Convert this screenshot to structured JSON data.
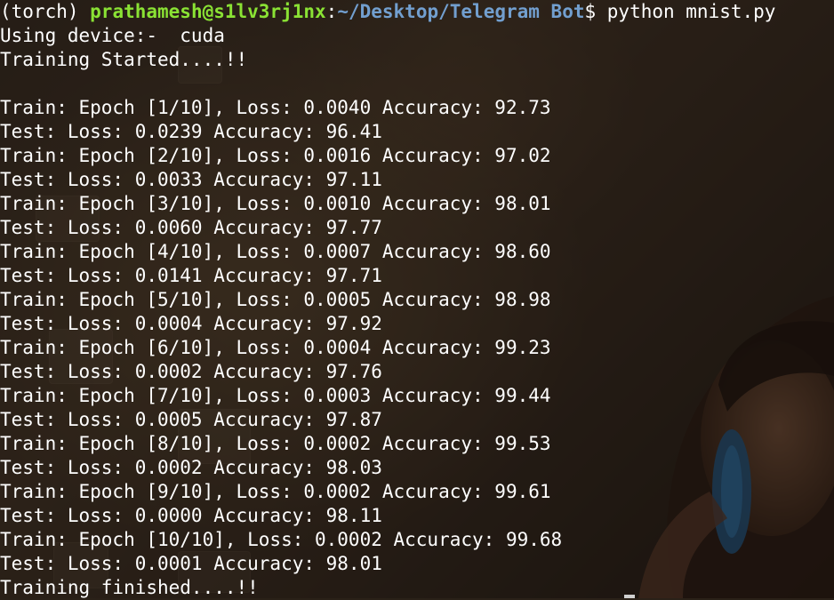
{
  "prompt": {
    "env": "(torch) ",
    "user_host": "prathamesh@s1lv3rj1nx",
    "separator": ":",
    "path": "~/Desktop/Telegram Bot",
    "symbol": "$ ",
    "command": "python mnist.py"
  },
  "output": {
    "device_line": "Using device:-  cuda",
    "start_line": "Training Started....!!",
    "blank_line": "",
    "epochs": [
      {
        "train": "Train: Epoch [1/10], Loss: 0.0040 Accuracy: 92.73",
        "test": "Test: Loss: 0.0239 Accuracy: 96.41"
      },
      {
        "train": "Train: Epoch [2/10], Loss: 0.0016 Accuracy: 97.02",
        "test": "Test: Loss: 0.0033 Accuracy: 97.11"
      },
      {
        "train": "Train: Epoch [3/10], Loss: 0.0010 Accuracy: 98.01",
        "test": "Test: Loss: 0.0060 Accuracy: 97.77"
      },
      {
        "train": "Train: Epoch [4/10], Loss: 0.0007 Accuracy: 98.60",
        "test": "Test: Loss: 0.0141 Accuracy: 97.71"
      },
      {
        "train": "Train: Epoch [5/10], Loss: 0.0005 Accuracy: 98.98",
        "test": "Test: Loss: 0.0004 Accuracy: 97.92"
      },
      {
        "train": "Train: Epoch [6/10], Loss: 0.0004 Accuracy: 99.23",
        "test": "Test: Loss: 0.0002 Accuracy: 97.76"
      },
      {
        "train": "Train: Epoch [7/10], Loss: 0.0003 Accuracy: 99.44",
        "test": "Test: Loss: 0.0005 Accuracy: 97.87"
      },
      {
        "train": "Train: Epoch [8/10], Loss: 0.0002 Accuracy: 99.53",
        "test": "Test: Loss: 0.0002 Accuracy: 98.03"
      },
      {
        "train": "Train: Epoch [9/10], Loss: 0.0002 Accuracy: 99.61",
        "test": "Test: Loss: 0.0000 Accuracy: 98.11"
      },
      {
        "train": "Train: Epoch [10/10], Loss: 0.0002 Accuracy: 99.68",
        "test": "Test: Loss: 0.0001 Accuracy: 98.01"
      }
    ],
    "finish_line": "Training finished....!!"
  },
  "colors": {
    "text": "#ffffff",
    "user_host": "#8ae234",
    "path": "#729fcf"
  }
}
